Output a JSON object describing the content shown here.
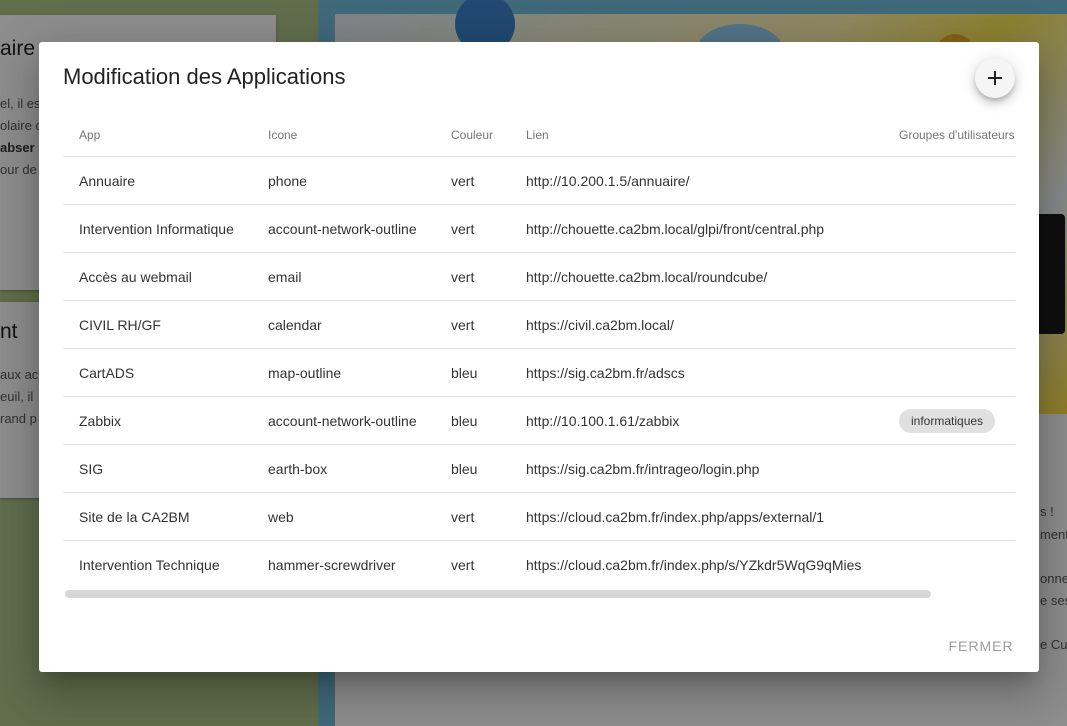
{
  "background": {
    "card1": {
      "title": "aire",
      "lines": [
        "el, il es",
        "olaire c",
        "abser",
        "our de"
      ]
    },
    "card2": {
      "title": "nt",
      "lines": [
        "aux ac",
        "euil, il",
        "rand p"
      ]
    },
    "right_lines": [
      "s !",
      "ment",
      "onne",
      "e ses",
      "e Cu"
    ]
  },
  "dialog": {
    "title": "Modification des Applications",
    "add_button_symbol": "+",
    "columns": [
      "App",
      "Icone",
      "Couleur",
      "Lien",
      "Groupes d'utilisateurs"
    ],
    "rows": [
      {
        "app": "Annuaire",
        "icone": "phone",
        "couleur": "vert",
        "lien": "http://10.200.1.5/annuaire/",
        "groupes": ""
      },
      {
        "app": "Intervention Informatique",
        "icone": "account-network-outline",
        "couleur": "vert",
        "lien": "http://chouette.ca2bm.local/glpi/front/central.php",
        "groupes": ""
      },
      {
        "app": "Accès au webmail",
        "icone": "email",
        "couleur": "vert",
        "lien": "http://chouette.ca2bm.local/roundcube/",
        "groupes": ""
      },
      {
        "app": "CIVIL RH/GF",
        "icone": "calendar",
        "couleur": "vert",
        "lien": "https://civil.ca2bm.local/",
        "groupes": ""
      },
      {
        "app": "CartADS",
        "icone": "map-outline",
        "couleur": "bleu",
        "lien": "https://sig.ca2bm.fr/adscs",
        "groupes": ""
      },
      {
        "app": "Zabbix",
        "icone": "account-network-outline",
        "couleur": "bleu",
        "lien": "http://10.100.1.61/zabbix",
        "groupes": "informatiques"
      },
      {
        "app": "SIG",
        "icone": "earth-box",
        "couleur": "bleu",
        "lien": "https://sig.ca2bm.fr/intrageo/login.php",
        "groupes": ""
      },
      {
        "app": "Site de la CA2BM",
        "icone": "web",
        "couleur": "vert",
        "lien": "https://cloud.ca2bm.fr/index.php/apps/external/1",
        "groupes": ""
      },
      {
        "app": "Intervention Technique",
        "icone": "hammer-screwdriver",
        "couleur": "vert",
        "lien": "https://cloud.ca2bm.fr/index.php/s/YZkdr5WqG9qMies",
        "groupes": ""
      }
    ],
    "close_label": "FERMER"
  },
  "colors": {
    "scrim": "#000000",
    "dialog_bg": "#ffffff",
    "chip_bg": "#e0e0e0",
    "close_text": "#9e9e9e"
  }
}
